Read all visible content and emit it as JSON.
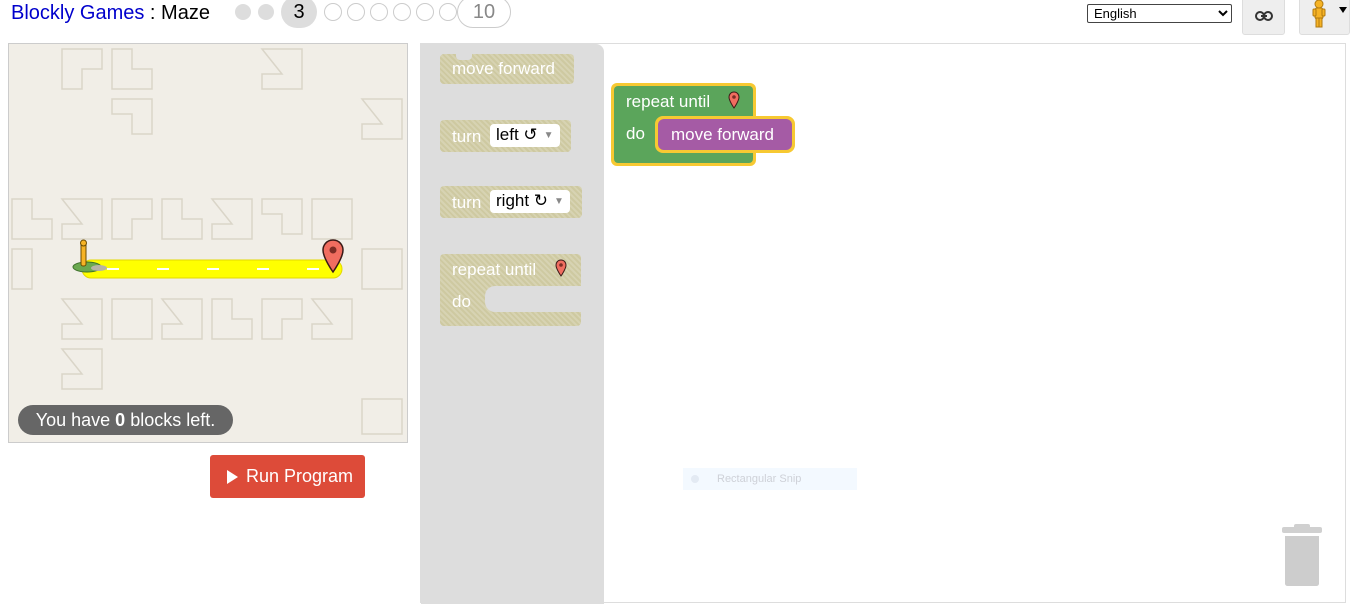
{
  "header": {
    "app_name": "Blockly Games",
    "separator": " : ",
    "game_name": "Maze",
    "levels": [
      "1",
      "2",
      "3",
      "4",
      "5",
      "6",
      "7",
      "8",
      "9",
      "10"
    ],
    "current_level": "3",
    "last_level": "10",
    "language": "English",
    "language_options": [
      "English"
    ]
  },
  "maze": {
    "capacity_prefix": "You have ",
    "capacity_count": "0",
    "capacity_suffix": " blocks left.",
    "run_label": "Run Program"
  },
  "toolbox": {
    "move_forward": "move forward",
    "turn": "turn",
    "left": "left ↺",
    "right": "right ↻",
    "repeat_until": "repeat until",
    "do": "do"
  },
  "program": {
    "repeat_until": "repeat until",
    "do": "do",
    "move_forward": "move forward"
  },
  "overlay": {
    "snip_label": "Rectangular Snip"
  },
  "colors": {
    "loop_block": "#5ba55b",
    "move_block": "#a55ba5",
    "disabled_block": "#cec9a1",
    "run_button": "#dd4b39",
    "path": "#ffff00",
    "highlight": "#f7c932"
  }
}
